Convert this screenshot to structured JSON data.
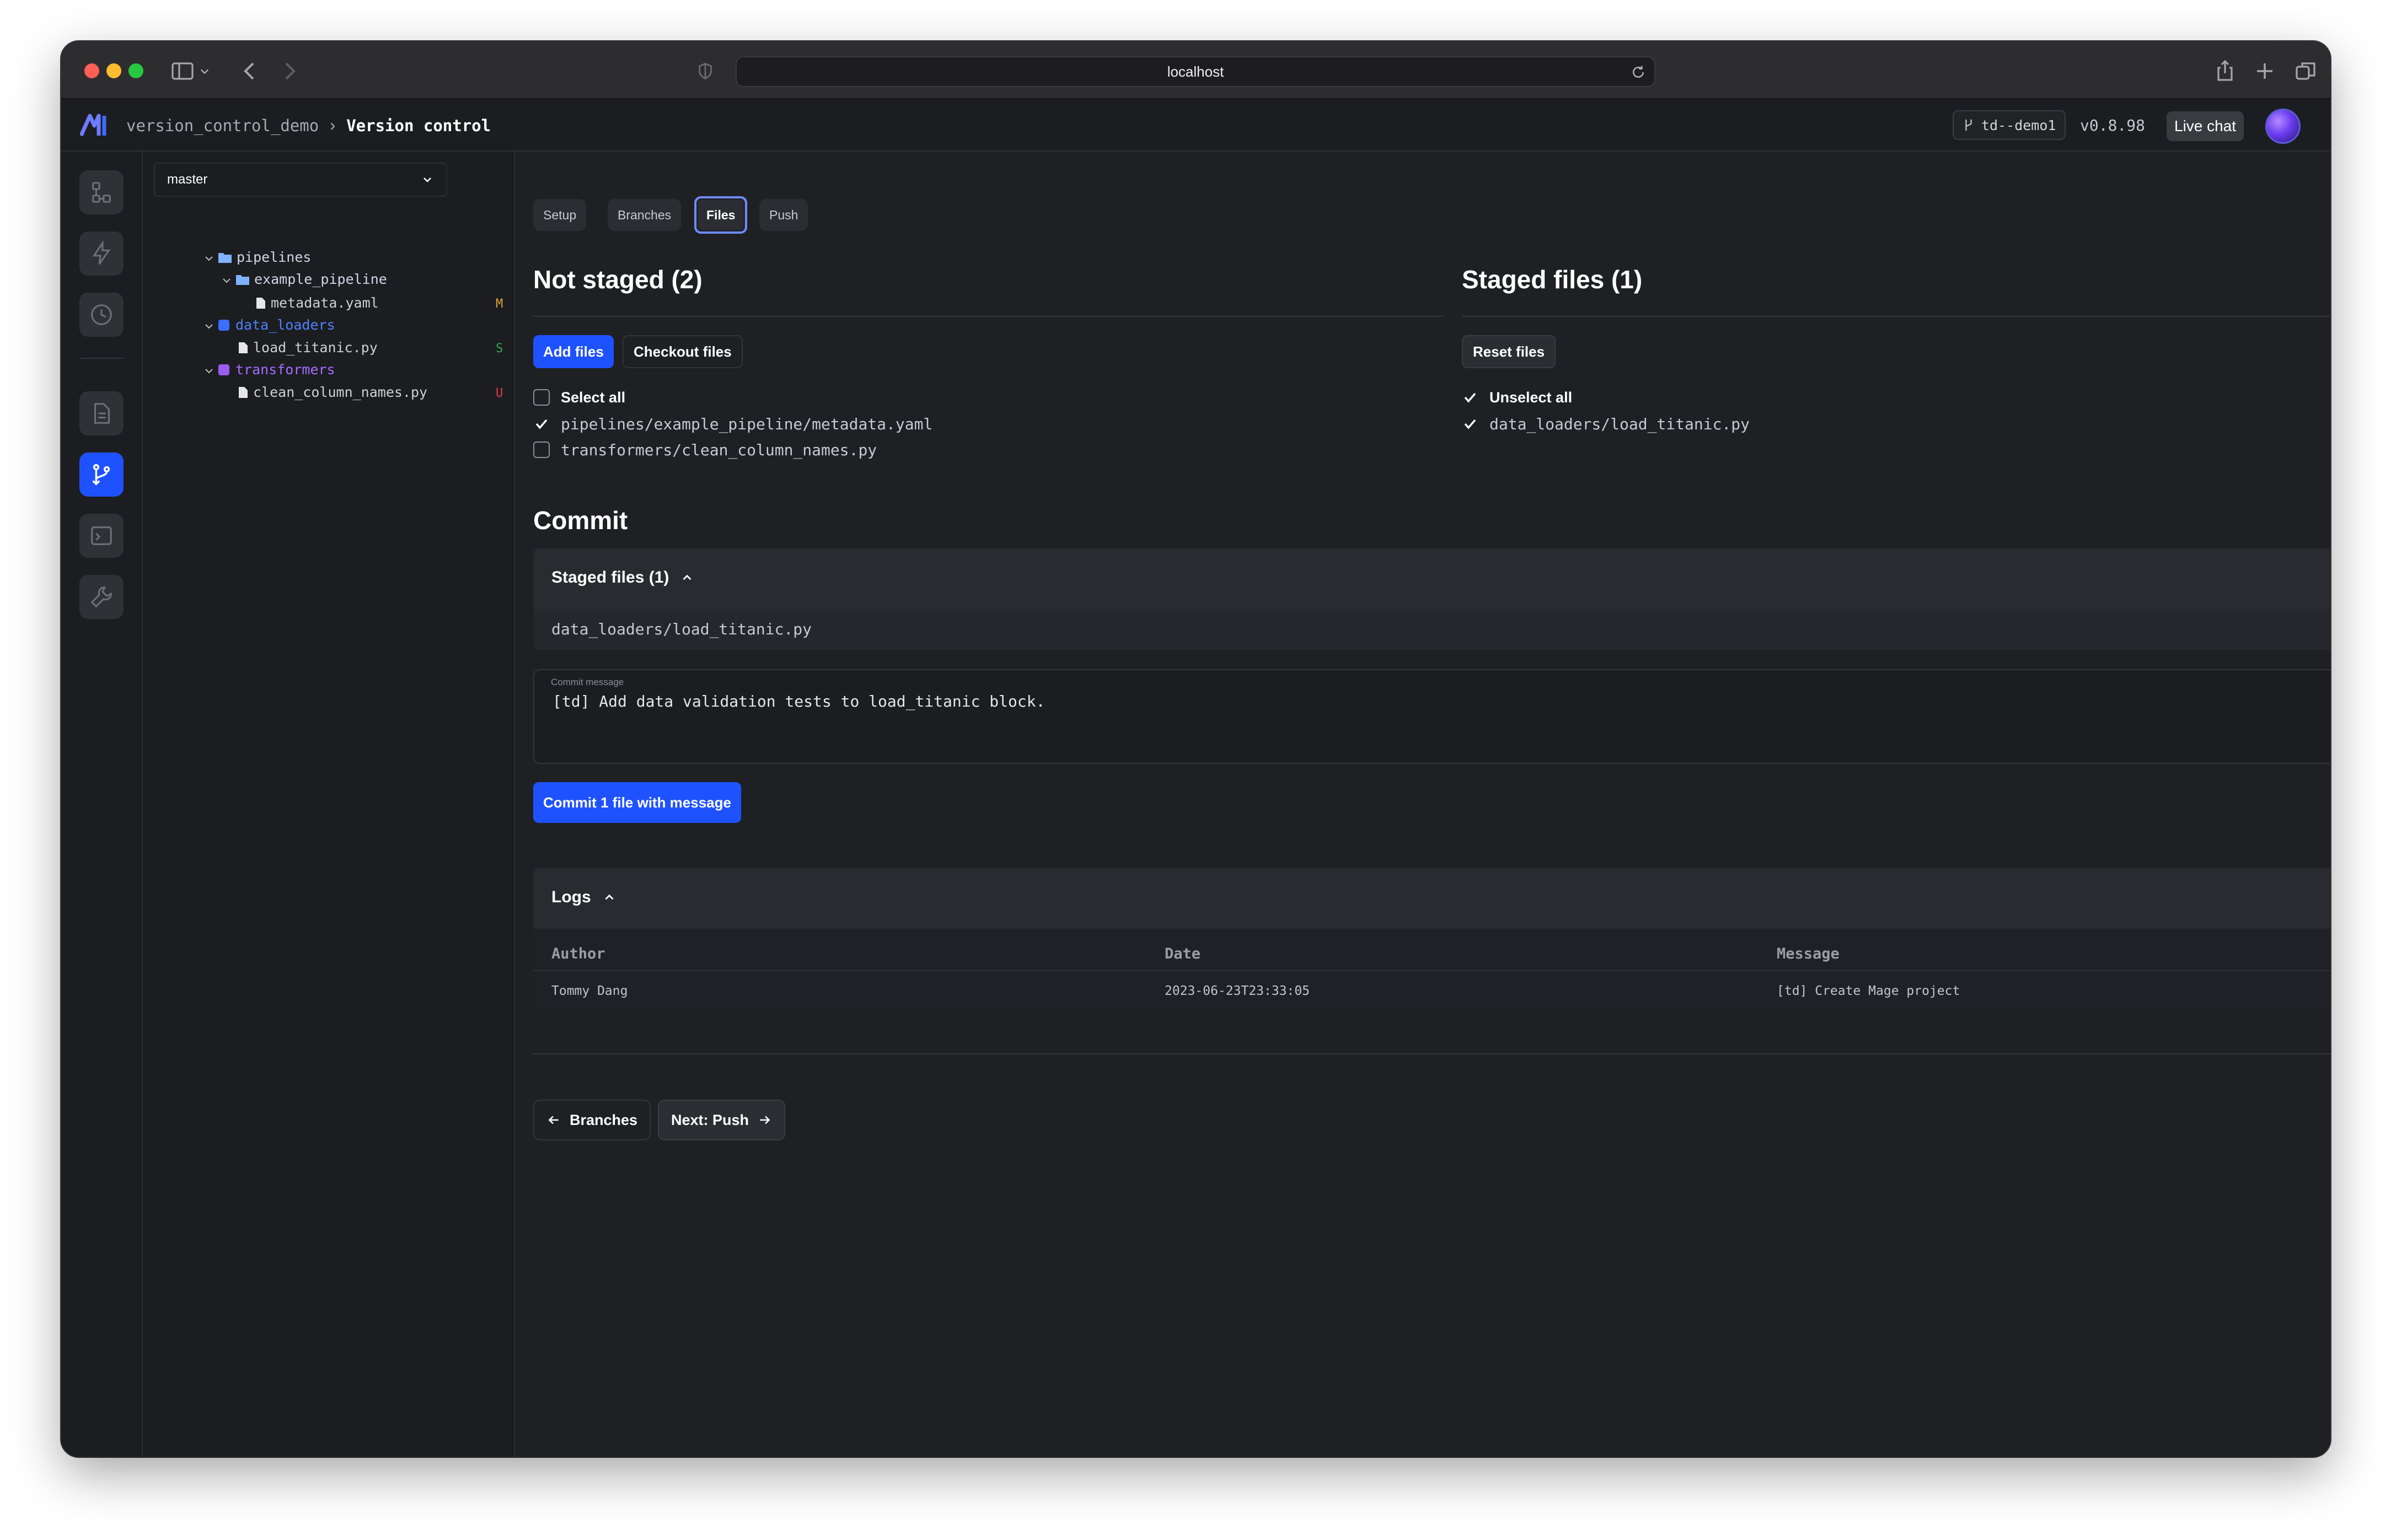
{
  "browser": {
    "url": "localhost"
  },
  "header": {
    "project": "version_control_demo",
    "page": "Version control",
    "branch_pill": "td--demo1",
    "version": "v0.8.98",
    "live_chat": "Live chat"
  },
  "sidebar_tree": {
    "branch_select": "master",
    "items": [
      {
        "name": "pipelines",
        "color": "#7fb2ff"
      },
      {
        "name": "example_pipeline",
        "color": "#7fb2ff"
      },
      {
        "name": "metadata.yaml",
        "status": "M",
        "status_color": "#d9a43b"
      },
      {
        "name": "data_loaders",
        "color": "#3b6dff"
      },
      {
        "name": "load_titanic.py",
        "status": "S",
        "status_color": "#2fa84f"
      },
      {
        "name": "transformers",
        "color": "#9b5cf0"
      },
      {
        "name": "clean_column_names.py",
        "status": "U",
        "status_color": "#e6394c"
      }
    ]
  },
  "tabs": [
    "Setup",
    "Branches",
    "Files",
    "Push"
  ],
  "active_tab": "Files",
  "not_staged": {
    "title": "Not staged (2)",
    "add_button": "Add files",
    "checkout_button": "Checkout files",
    "select_all": "Select all",
    "files": [
      {
        "path": "pipelines/example_pipeline/metadata.yaml",
        "checked": true
      },
      {
        "path": "transformers/clean_column_names.py",
        "checked": false
      }
    ]
  },
  "staged": {
    "title": "Staged files (1)",
    "reset_button": "Reset files",
    "unselect_all": "Unselect all",
    "files": [
      {
        "path": "data_loaders/load_titanic.py",
        "checked": true
      }
    ]
  },
  "commit": {
    "title": "Commit",
    "staged_header": "Staged files (1)",
    "staged_files": [
      "data_loaders/load_titanic.py"
    ],
    "message_label": "Commit message",
    "message": "[td] Add data validation tests to load_titanic block.",
    "commit_button": "Commit 1 file with message"
  },
  "logs": {
    "title": "Logs",
    "columns": [
      "Author",
      "Date",
      "Message"
    ],
    "rows": [
      [
        "Tommy Dang",
        "2023-06-23T23:33:05",
        "[td] Create Mage project"
      ]
    ]
  },
  "footer_nav": {
    "back": "Branches",
    "next": "Next: Push"
  },
  "colors": {
    "accent": "#1f52ff",
    "background": "#1f2024"
  }
}
